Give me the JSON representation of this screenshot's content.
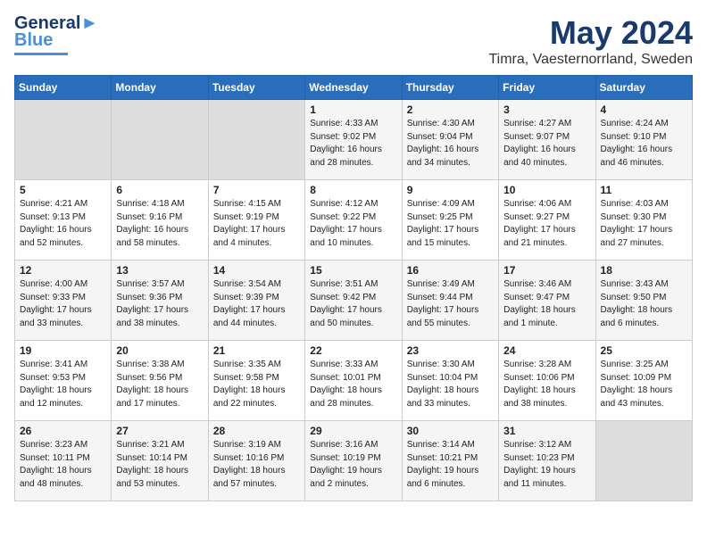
{
  "header": {
    "logo_line1": "General",
    "logo_line2": "Blue",
    "month": "May 2024",
    "location": "Timra, Vaesternorrland, Sweden"
  },
  "days_of_week": [
    "Sunday",
    "Monday",
    "Tuesday",
    "Wednesday",
    "Thursday",
    "Friday",
    "Saturday"
  ],
  "weeks": [
    [
      {
        "day": "",
        "info": ""
      },
      {
        "day": "",
        "info": ""
      },
      {
        "day": "",
        "info": ""
      },
      {
        "day": "1",
        "info": "Sunrise: 4:33 AM\nSunset: 9:02 PM\nDaylight: 16 hours\nand 28 minutes."
      },
      {
        "day": "2",
        "info": "Sunrise: 4:30 AM\nSunset: 9:04 PM\nDaylight: 16 hours\nand 34 minutes."
      },
      {
        "day": "3",
        "info": "Sunrise: 4:27 AM\nSunset: 9:07 PM\nDaylight: 16 hours\nand 40 minutes."
      },
      {
        "day": "4",
        "info": "Sunrise: 4:24 AM\nSunset: 9:10 PM\nDaylight: 16 hours\nand 46 minutes."
      }
    ],
    [
      {
        "day": "5",
        "info": "Sunrise: 4:21 AM\nSunset: 9:13 PM\nDaylight: 16 hours\nand 52 minutes."
      },
      {
        "day": "6",
        "info": "Sunrise: 4:18 AM\nSunset: 9:16 PM\nDaylight: 16 hours\nand 58 minutes."
      },
      {
        "day": "7",
        "info": "Sunrise: 4:15 AM\nSunset: 9:19 PM\nDaylight: 17 hours\nand 4 minutes."
      },
      {
        "day": "8",
        "info": "Sunrise: 4:12 AM\nSunset: 9:22 PM\nDaylight: 17 hours\nand 10 minutes."
      },
      {
        "day": "9",
        "info": "Sunrise: 4:09 AM\nSunset: 9:25 PM\nDaylight: 17 hours\nand 15 minutes."
      },
      {
        "day": "10",
        "info": "Sunrise: 4:06 AM\nSunset: 9:27 PM\nDaylight: 17 hours\nand 21 minutes."
      },
      {
        "day": "11",
        "info": "Sunrise: 4:03 AM\nSunset: 9:30 PM\nDaylight: 17 hours\nand 27 minutes."
      }
    ],
    [
      {
        "day": "12",
        "info": "Sunrise: 4:00 AM\nSunset: 9:33 PM\nDaylight: 17 hours\nand 33 minutes."
      },
      {
        "day": "13",
        "info": "Sunrise: 3:57 AM\nSunset: 9:36 PM\nDaylight: 17 hours\nand 38 minutes."
      },
      {
        "day": "14",
        "info": "Sunrise: 3:54 AM\nSunset: 9:39 PM\nDaylight: 17 hours\nand 44 minutes."
      },
      {
        "day": "15",
        "info": "Sunrise: 3:51 AM\nSunset: 9:42 PM\nDaylight: 17 hours\nand 50 minutes."
      },
      {
        "day": "16",
        "info": "Sunrise: 3:49 AM\nSunset: 9:44 PM\nDaylight: 17 hours\nand 55 minutes."
      },
      {
        "day": "17",
        "info": "Sunrise: 3:46 AM\nSunset: 9:47 PM\nDaylight: 18 hours\nand 1 minute."
      },
      {
        "day": "18",
        "info": "Sunrise: 3:43 AM\nSunset: 9:50 PM\nDaylight: 18 hours\nand 6 minutes."
      }
    ],
    [
      {
        "day": "19",
        "info": "Sunrise: 3:41 AM\nSunset: 9:53 PM\nDaylight: 18 hours\nand 12 minutes."
      },
      {
        "day": "20",
        "info": "Sunrise: 3:38 AM\nSunset: 9:56 PM\nDaylight: 18 hours\nand 17 minutes."
      },
      {
        "day": "21",
        "info": "Sunrise: 3:35 AM\nSunset: 9:58 PM\nDaylight: 18 hours\nand 22 minutes."
      },
      {
        "day": "22",
        "info": "Sunrise: 3:33 AM\nSunset: 10:01 PM\nDaylight: 18 hours\nand 28 minutes."
      },
      {
        "day": "23",
        "info": "Sunrise: 3:30 AM\nSunset: 10:04 PM\nDaylight: 18 hours\nand 33 minutes."
      },
      {
        "day": "24",
        "info": "Sunrise: 3:28 AM\nSunset: 10:06 PM\nDaylight: 18 hours\nand 38 minutes."
      },
      {
        "day": "25",
        "info": "Sunrise: 3:25 AM\nSunset: 10:09 PM\nDaylight: 18 hours\nand 43 minutes."
      }
    ],
    [
      {
        "day": "26",
        "info": "Sunrise: 3:23 AM\nSunset: 10:11 PM\nDaylight: 18 hours\nand 48 minutes."
      },
      {
        "day": "27",
        "info": "Sunrise: 3:21 AM\nSunset: 10:14 PM\nDaylight: 18 hours\nand 53 minutes."
      },
      {
        "day": "28",
        "info": "Sunrise: 3:19 AM\nSunset: 10:16 PM\nDaylight: 18 hours\nand 57 minutes."
      },
      {
        "day": "29",
        "info": "Sunrise: 3:16 AM\nSunset: 10:19 PM\nDaylight: 19 hours\nand 2 minutes."
      },
      {
        "day": "30",
        "info": "Sunrise: 3:14 AM\nSunset: 10:21 PM\nDaylight: 19 hours\nand 6 minutes."
      },
      {
        "day": "31",
        "info": "Sunrise: 3:12 AM\nSunset: 10:23 PM\nDaylight: 19 hours\nand 11 minutes."
      },
      {
        "day": "",
        "info": ""
      }
    ]
  ]
}
